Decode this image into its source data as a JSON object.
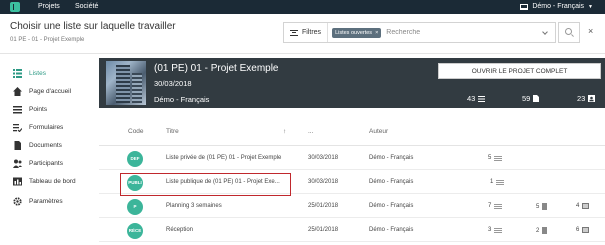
{
  "topnav": {
    "items": [
      "Projets",
      "Société"
    ],
    "user": "Démo - Français"
  },
  "header": {
    "title": "Choisir une liste sur laquelle travailler",
    "breadcrumb": "01 PE - 01 - Projet Exemple",
    "filter_label": "Filtres",
    "filter_chip": "Listes ouvertes",
    "filter_chip_close": "×",
    "search_placeholder": "Recherche",
    "close": "×"
  },
  "sidebar": {
    "items": [
      {
        "label": "Listes",
        "icon": "list-icon",
        "active": true
      },
      {
        "label": "Page d'accueil",
        "icon": "home-icon"
      },
      {
        "label": "Points",
        "icon": "points-icon"
      },
      {
        "label": "Formulaires",
        "icon": "forms-icon"
      },
      {
        "label": "Documents",
        "icon": "documents-icon"
      },
      {
        "label": "Participants",
        "icon": "participants-icon"
      },
      {
        "label": "Tableau de bord",
        "icon": "dashboard-icon"
      },
      {
        "label": "Paramètres",
        "icon": "gear-icon"
      }
    ]
  },
  "project": {
    "title": "(01 PE) 01 - Projet Exemple",
    "date": "30/03/2018",
    "owner": "Démo - Français",
    "open_button": "OUVRIR LE PROJET COMPLET",
    "stats": {
      "lists": "43",
      "documents": "59",
      "participants": "23"
    }
  },
  "table": {
    "headers": {
      "code": "Code",
      "title": "Titre",
      "sort": "↑",
      "date": "...",
      "author": "Auteur"
    },
    "rows": [
      {
        "code": "DEF",
        "title": "Liste privée de (01 PE) 01 - Projet Exemple",
        "date": "30/03/2018",
        "author": "Démo - Français",
        "points": "5",
        "docs": "",
        "participants": ""
      },
      {
        "code": "PUBLI",
        "title": "Liste publique de (01 PE) 01 - Projet Exe...",
        "date": "30/03/2018",
        "author": "Démo - Français",
        "points": "1",
        "docs": "",
        "participants": ""
      },
      {
        "code": "P",
        "title": "Planning 3 semaines",
        "date": "25/01/2018",
        "author": "Démo - Français",
        "points": "7",
        "docs": "5",
        "participants": "4"
      },
      {
        "code": "RÉCE",
        "title": "Réception",
        "date": "25/01/2018",
        "author": "Démo - Français",
        "points": "3",
        "docs": "2",
        "participants": "6"
      }
    ]
  },
  "colors": {
    "accent": "#3cb59a",
    "topbar": "#1b2a36",
    "card": "#323b41",
    "highlight": "#c0282d"
  }
}
